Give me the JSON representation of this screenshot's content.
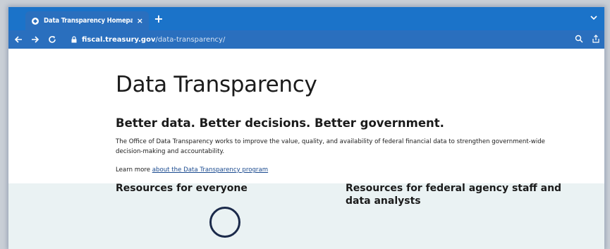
{
  "browser": {
    "tab_title": "Data Transparency Homepage",
    "tab_close": "×",
    "new_tab": "+",
    "url_host": "fiscal.treasury.gov",
    "url_path": "/data-transparency/",
    "icons": [
      "back-arrow-icon",
      "forward-arrow-icon",
      "reload-icon",
      "lock-icon",
      "search-icon",
      "share-icon",
      "tab-menu-chevron-icon"
    ],
    "colors": {
      "chrome": "#1b73c9",
      "toolbar": "#2a6fbe"
    }
  },
  "page": {
    "title": "Data Transparency",
    "tagline": "Better data. Better decisions. Better government.",
    "intro": "The Office of Data Transparency works to improve the value, quality, and availability of federal financial data to strengthen government-wide decision-making and accountability.",
    "learn_more_prefix": "Learn more ",
    "learn_more_link": "about the Data Transparency program",
    "resources_everyone": "Resources for everyone",
    "resources_federal": "Resources for federal agency staff and data analysts",
    "colors": {
      "band": "#eaf2f3",
      "link": "#1a4a8f"
    }
  }
}
